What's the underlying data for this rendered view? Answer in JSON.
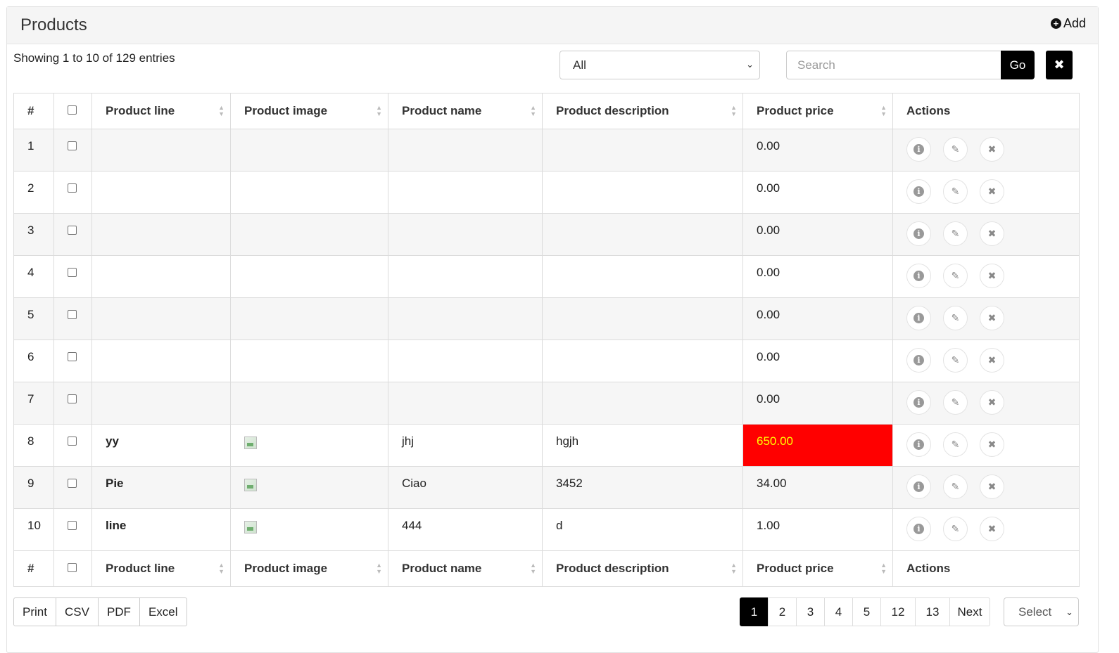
{
  "panel": {
    "title": "Products",
    "add_label": "Add"
  },
  "toolbar": {
    "showing_text": "Showing 1 to 10 of 129 entries",
    "filter_selected": "All",
    "search_placeholder": "Search",
    "search_value": "",
    "go_label": "Go",
    "clear_icon": "close-icon"
  },
  "table": {
    "headers": [
      "#",
      "",
      "Product line",
      "Product image",
      "Product name",
      "Product description",
      "Product price",
      "Actions"
    ],
    "rows": [
      {
        "n": "1",
        "line": "",
        "has_image": false,
        "name": "",
        "description": "",
        "price": "0.00",
        "highlight": false
      },
      {
        "n": "2",
        "line": "",
        "has_image": false,
        "name": "",
        "description": "",
        "price": "0.00",
        "highlight": false
      },
      {
        "n": "3",
        "line": "",
        "has_image": false,
        "name": "",
        "description": "",
        "price": "0.00",
        "highlight": false
      },
      {
        "n": "4",
        "line": "",
        "has_image": false,
        "name": "",
        "description": "",
        "price": "0.00",
        "highlight": false
      },
      {
        "n": "5",
        "line": "",
        "has_image": false,
        "name": "",
        "description": "",
        "price": "0.00",
        "highlight": false
      },
      {
        "n": "6",
        "line": "",
        "has_image": false,
        "name": "",
        "description": "",
        "price": "0.00",
        "highlight": false
      },
      {
        "n": "7",
        "line": "",
        "has_image": false,
        "name": "",
        "description": "",
        "price": "0.00",
        "highlight": false
      },
      {
        "n": "8",
        "line": "yy",
        "has_image": true,
        "name": "jhj",
        "description": "hgjh",
        "price": "650.00",
        "highlight": true
      },
      {
        "n": "9",
        "line": "Pie",
        "has_image": true,
        "name": "Ciao",
        "description": "3452",
        "price": "34.00",
        "highlight": false
      },
      {
        "n": "10",
        "line": "line",
        "has_image": true,
        "name": "444",
        "description": "d",
        "price": "1.00",
        "highlight": false
      }
    ],
    "highlight_colors": {
      "background": "#ff0000",
      "text": "#ffff00"
    }
  },
  "export": {
    "buttons": [
      "Print",
      "CSV",
      "PDF",
      "Excel"
    ]
  },
  "pagination": {
    "pages": [
      "1",
      "2",
      "3",
      "4",
      "5",
      "12",
      "13"
    ],
    "current": "1",
    "next_label": "Next",
    "page_size_selected": "Select"
  }
}
